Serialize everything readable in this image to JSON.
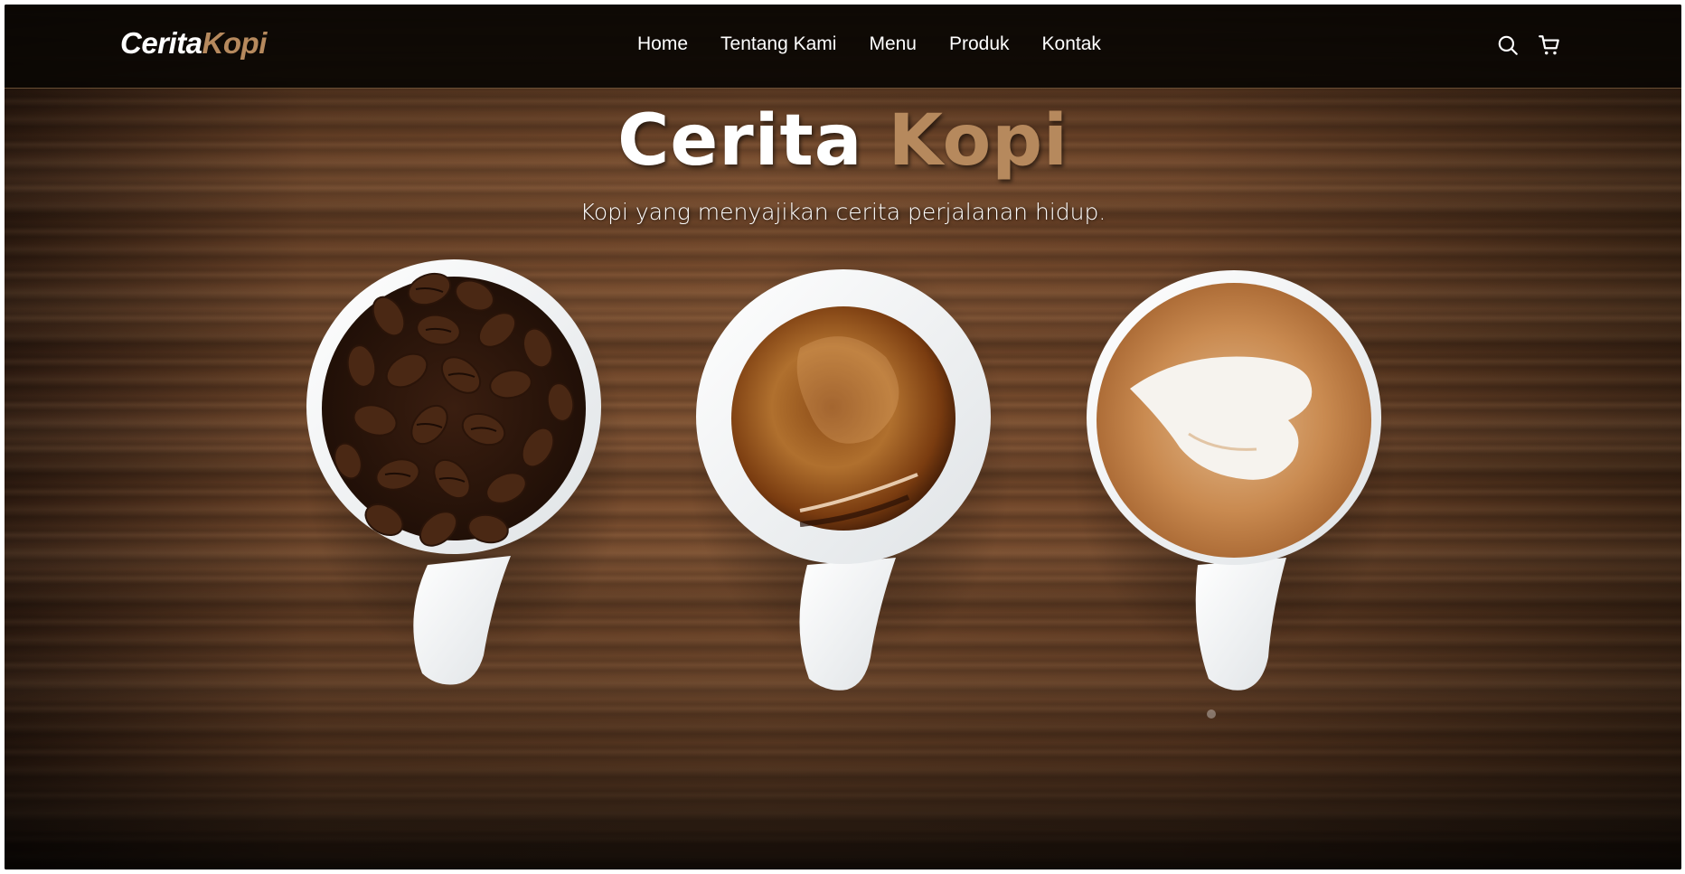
{
  "brand": {
    "name_main": "Cerita",
    "name_accent": "Kopi",
    "accent_color": "#b6895d"
  },
  "nav": {
    "items": [
      {
        "label": "Home"
      },
      {
        "label": "Tentang Kami"
      },
      {
        "label": "Menu"
      },
      {
        "label": "Produk"
      },
      {
        "label": "Kontak"
      }
    ],
    "icons": [
      "search-icon",
      "cart-icon"
    ]
  },
  "hero": {
    "title_main": "Cerita",
    "title_accent": "Kopi",
    "subtitle": "Kopi yang menyajikan cerita perjalanan hidup.",
    "image_items": [
      "coffee-beans-cup",
      "espresso-cup",
      "latte-art-cup"
    ]
  }
}
